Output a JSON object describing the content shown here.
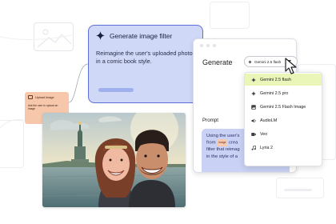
{
  "filter_card": {
    "title": "Generate image filter",
    "description": "Reimagine the user's uploaded photo in a comic book style."
  },
  "upload_card": {
    "title": "Upload Image",
    "text": "Ask the user to upload an image"
  },
  "generate_panel": {
    "title": "Generate",
    "prompt_label": "Prompt",
    "prompt_text_1": "Using the user's",
    "prompt_text_2": "from",
    "prompt_tag": "Image",
    "prompt_text_3": "crea",
    "prompt_text_4": "filter that reimag",
    "prompt_text_5": "in the style of a"
  },
  "model_select": {
    "selected": "Gemini 2.5 flash",
    "icon": "gemini-spark-icon"
  },
  "model_menu": {
    "items": [
      {
        "label": "Gemini 2.5 flash",
        "icon": "gemini-spark-icon",
        "selected": true
      },
      {
        "label": "Gemini 2.5 pro",
        "icon": "gemini-spark-icon",
        "selected": false
      },
      {
        "label": "Gemini 2.5 Flash Image",
        "icon": "image-icon",
        "selected": false
      },
      {
        "label": "AudioLM",
        "icon": "audio-icon",
        "selected": false
      },
      {
        "label": "Veo",
        "icon": "video-icon",
        "selected": false
      },
      {
        "label": "Lyria 2",
        "icon": "music-icon",
        "selected": false
      }
    ]
  },
  "colors": {
    "filter_card_bg": "#cfd8f7",
    "filter_card_border": "#5b6fd9",
    "upload_card_bg": "#f6c7ab",
    "prompt_box_bg": "#c9d2f5",
    "menu_selected_bg": "#eaf6b8"
  }
}
